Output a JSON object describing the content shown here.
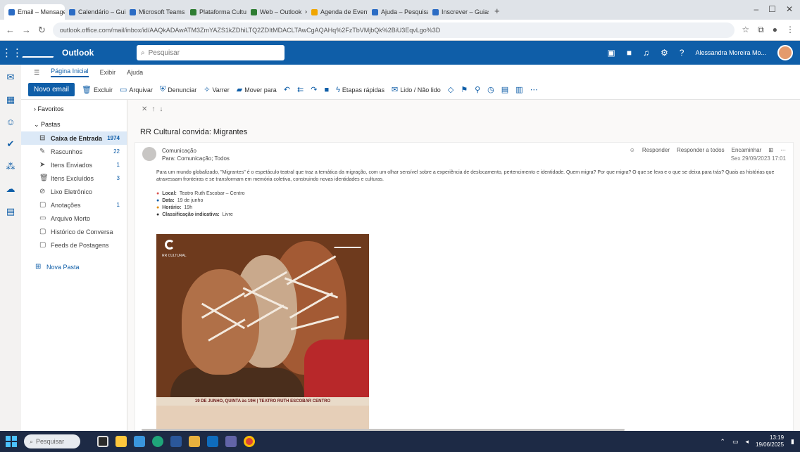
{
  "browser": {
    "tabs": [
      {
        "label": "Email – Mensagem de...",
        "active": true
      },
      {
        "label": "Calendário – Guia...",
        "active": false
      },
      {
        "label": "Microsoft Teams",
        "active": false
      },
      {
        "label": "Plataforma Cultural",
        "active": false
      },
      {
        "label": "Web – Outlook",
        "active": false
      },
      {
        "label": "Agenda de Eventos",
        "active": false
      },
      {
        "label": "Ajuda – Pesquisa",
        "active": false
      },
      {
        "label": "Inscrever – Guias",
        "active": false
      }
    ],
    "url": "outlook.office.com/mail/inbox/id/AAQkADAwATM3ZmYAZS1kZDhiLTQ2ZDItMDACLTAwCgAQAHq%2FzTbVMjbQk%2BiU3EqvLgo%3D"
  },
  "outlook": {
    "app_name": "Outlook",
    "search_placeholder": "Pesquisar",
    "user_name": "Alessandra Moreira Mo...",
    "ribbon_tabs": [
      "Página Inicial",
      "Exibir",
      "Ajuda"
    ],
    "ribbon": {
      "new_mail": "Novo email",
      "delete": "Excluir",
      "archive": "Arquivar",
      "report": "Denunciar",
      "sweep": "Varrer",
      "move": "Mover para",
      "quick_steps": "Etapas rápidas",
      "read_unread": "Lido / Não lido"
    },
    "folders": {
      "favorites_label": "Favoritos",
      "folders_label": "Pastas",
      "items": [
        {
          "label": "Caixa de Entrada",
          "count": "1974",
          "icon": "inbox-icon",
          "selected": true
        },
        {
          "label": "Rascunhos",
          "count": "22",
          "icon": "draft-icon",
          "selected": false
        },
        {
          "label": "Itens Enviados",
          "count": "1",
          "icon": "sent-icon",
          "selected": false
        },
        {
          "label": "Itens Excluídos",
          "count": "3",
          "icon": "trash-icon",
          "selected": false
        },
        {
          "label": "Lixo Eletrônico",
          "count": "",
          "icon": "junk-icon",
          "selected": false
        },
        {
          "label": "Anotações",
          "count": "1",
          "icon": "notes-icon",
          "selected": false
        },
        {
          "label": "Arquivo Morto",
          "count": "",
          "icon": "archive-icon",
          "selected": false
        },
        {
          "label": "Histórico de Conversa",
          "count": "",
          "icon": "history-icon",
          "selected": false
        },
        {
          "label": "Feeds de Postagens",
          "count": "",
          "icon": "feed-icon",
          "selected": false
        }
      ],
      "new_group": "Nova Pasta"
    },
    "message": {
      "subject": "RR Cultural convida: Migrantes",
      "sender": "Comunicação",
      "to": "Para: Comunicação; Todos",
      "actions": [
        "Responder",
        "Responder a todos",
        "Encaminhar"
      ],
      "date": "Sex 29/09/2023 17:01",
      "body": "Para um mundo globalizado, \"Migrantes\" é o espetáculo teatral que traz a temática da migração, com um olhar sensível sobre a experiência de deslocamento, pertencimento e identidade. Quem migra? Por que migra? O que se leva e o que se deixa para trás? Quais as histórias que atravessam fronteiras e se transformam em memória coletiva, construindo novas identidades e culturas.",
      "info": [
        {
          "label": "Local:",
          "value": "Teatro Ruth Escobar – Centro"
        },
        {
          "label": "Data:",
          "value": "19 de junho"
        },
        {
          "label": "Horário:",
          "value": "19h"
        },
        {
          "label": "Classificação indicativa:",
          "value": "Livre"
        }
      ],
      "poster_brand": "RR CULTURAL",
      "poster_caption": "19 DE JUNHO, QUINTA às 19H | TEATRO RUTH ESCOBAR CENTRO"
    }
  },
  "taskbar": {
    "search_placeholder": "Pesquisar",
    "time": "13:19",
    "date": "19/06/2025"
  }
}
